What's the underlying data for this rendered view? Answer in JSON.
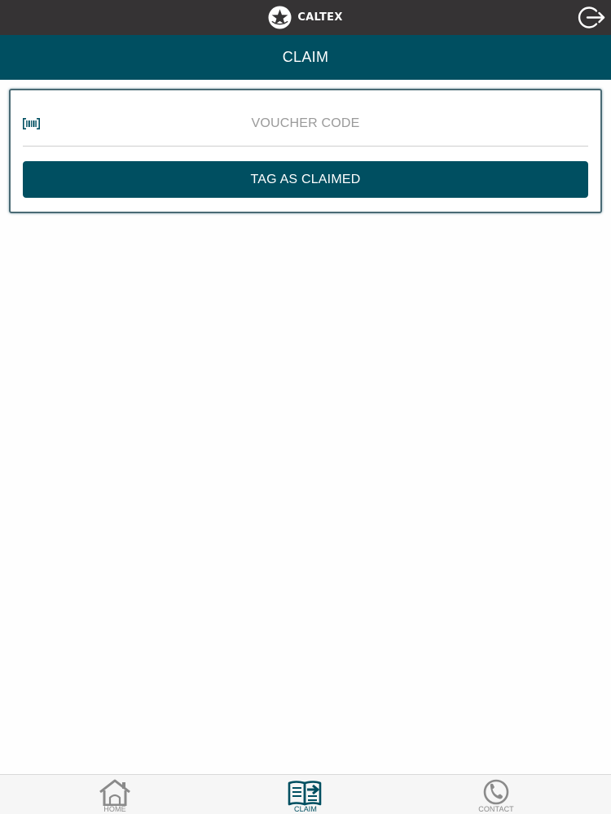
{
  "header": {
    "brand_name": "CALTEX",
    "brand_icon": "caltex-star-logo",
    "logout_icon": "logout-icon"
  },
  "titlebar": {
    "title": "CLAIM"
  },
  "claim_form": {
    "voucher_placeholder": "VOUCHER CODE",
    "voucher_value": "",
    "barcode_icon": "barcode-icon",
    "submit_label": "TAG AS CLAIMED"
  },
  "tabbar": {
    "active": "CLAIM",
    "tabs": [
      {
        "label": "HOME",
        "icon": "home-icon"
      },
      {
        "label": "CLAIM",
        "icon": "claim-icon"
      },
      {
        "label": "CONTACT",
        "icon": "contact-icon"
      }
    ]
  },
  "colors": {
    "topbar": "#353334",
    "brand_teal": "#004f61",
    "inactive_gray": "#8a8a8a"
  }
}
